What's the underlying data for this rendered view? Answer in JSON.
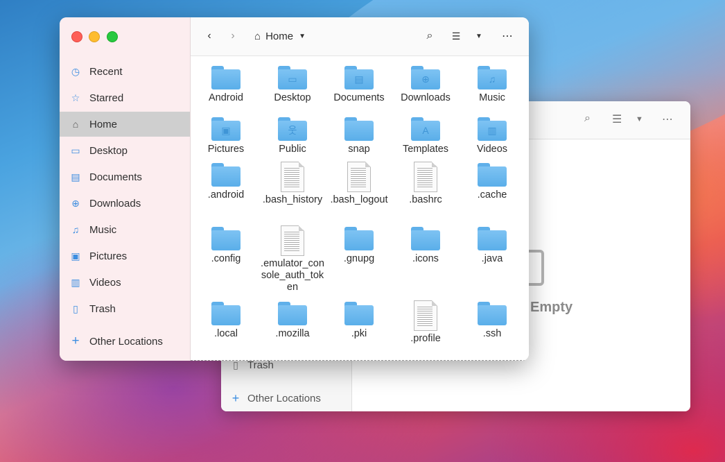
{
  "background_window": {
    "sidebar": [
      {
        "label": "Trash",
        "icon": "trash-icon"
      },
      {
        "label": "Other Locations",
        "icon": "plus-icon"
      }
    ],
    "empty_label": "Empty"
  },
  "window": {
    "sidebar": [
      {
        "label": "Recent",
        "icon": "clock-icon",
        "glyph": "◷"
      },
      {
        "label": "Starred",
        "icon": "star-icon",
        "glyph": "☆"
      },
      {
        "label": "Home",
        "icon": "home-icon",
        "glyph": "⌂"
      },
      {
        "label": "Desktop",
        "icon": "desktop-icon",
        "glyph": "▭"
      },
      {
        "label": "Documents",
        "icon": "documents-icon",
        "glyph": "▤"
      },
      {
        "label": "Downloads",
        "icon": "download-icon",
        "glyph": "⊕"
      },
      {
        "label": "Music",
        "icon": "music-icon",
        "glyph": "♫"
      },
      {
        "label": "Pictures",
        "icon": "camera-icon",
        "glyph": "▣"
      },
      {
        "label": "Videos",
        "icon": "film-icon",
        "glyph": "▥"
      },
      {
        "label": "Trash",
        "icon": "trash-icon",
        "glyph": "▯"
      },
      {
        "label": "Other Locations",
        "icon": "plus-icon",
        "glyph": "+"
      }
    ],
    "active_sidebar": "Home",
    "path": {
      "label": "Home"
    },
    "files": [
      {
        "name": "Android",
        "type": "folder"
      },
      {
        "name": "Desktop",
        "type": "folder",
        "emblem": "▭"
      },
      {
        "name": "Documents",
        "type": "folder",
        "emblem": "▤"
      },
      {
        "name": "Downloads",
        "type": "folder",
        "emblem": "⊕"
      },
      {
        "name": "Music",
        "type": "folder",
        "emblem": "♫"
      },
      {
        "name": "Pictures",
        "type": "folder",
        "emblem": "▣"
      },
      {
        "name": "Public",
        "type": "folder",
        "emblem": "웃"
      },
      {
        "name": "snap",
        "type": "folder"
      },
      {
        "name": "Templates",
        "type": "folder",
        "emblem": "A"
      },
      {
        "name": "Videos",
        "type": "folder",
        "emblem": "▥"
      },
      {
        "name": ".android",
        "type": "folder"
      },
      {
        "name": ".bash_history",
        "type": "file"
      },
      {
        "name": ".bash_logout",
        "type": "file"
      },
      {
        "name": ".bashrc",
        "type": "file"
      },
      {
        "name": ".cache",
        "type": "folder"
      },
      {
        "name": ".config",
        "type": "folder"
      },
      {
        "name": ".emulator_console_auth_token",
        "type": "file"
      },
      {
        "name": ".gnupg",
        "type": "folder"
      },
      {
        "name": ".icons",
        "type": "folder"
      },
      {
        "name": ".java",
        "type": "folder"
      },
      {
        "name": ".local",
        "type": "folder"
      },
      {
        "name": ".mozilla",
        "type": "folder"
      },
      {
        "name": ".pki",
        "type": "folder"
      },
      {
        "name": ".profile",
        "type": "file"
      },
      {
        "name": ".ssh",
        "type": "folder"
      }
    ]
  }
}
